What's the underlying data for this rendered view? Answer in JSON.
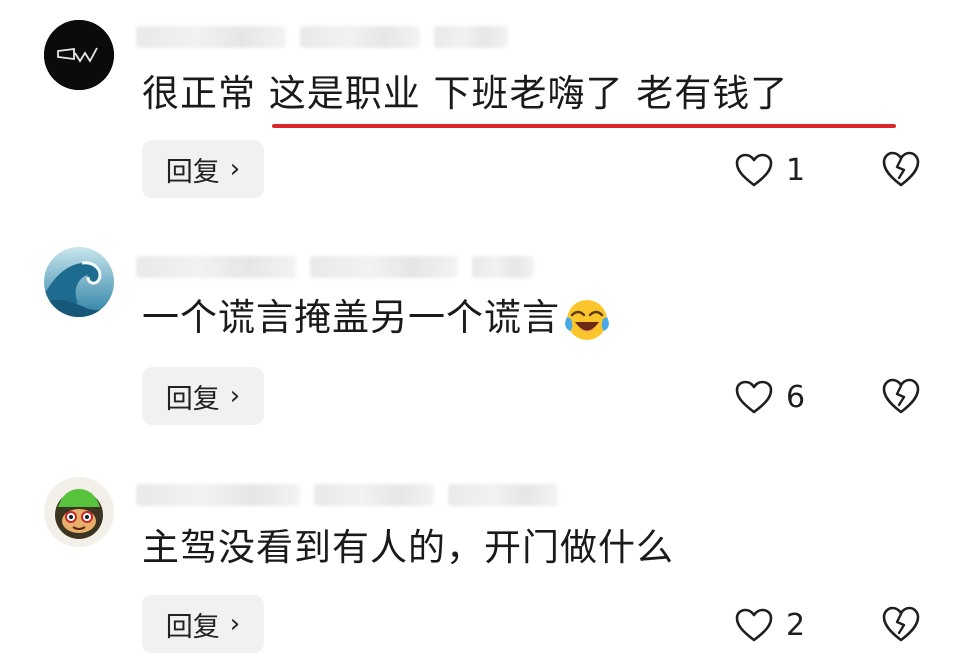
{
  "comments": [
    {
      "text": "很正常 这是职业 下班老嗨了 老有钱了",
      "reply_label": "回复",
      "reply_chevron": "›",
      "likes": "1",
      "avatar_icon": "logo-avatar-icon",
      "heart_icon": "heart-outline-icon",
      "dislike_icon": "broken-heart-icon"
    },
    {
      "text": "一个谎言掩盖另一个谎言",
      "emoji": "laughing-crying-emoji-icon",
      "reply_label": "回复",
      "reply_chevron": "›",
      "likes": "6",
      "avatar_icon": "wave-avatar-icon",
      "heart_icon": "heart-outline-icon",
      "dislike_icon": "broken-heart-icon"
    },
    {
      "text": "主驾没看到有人的，开门做什么",
      "reply_label": "回复",
      "reply_chevron": "›",
      "likes": "2",
      "avatar_icon": "monkey-avatar-icon",
      "heart_icon": "heart-outline-icon",
      "dislike_icon": "broken-heart-icon"
    }
  ],
  "colors": {
    "underline": "#d9262b",
    "reply_bg": "#f1f1f1",
    "text": "#1a1a1a"
  }
}
